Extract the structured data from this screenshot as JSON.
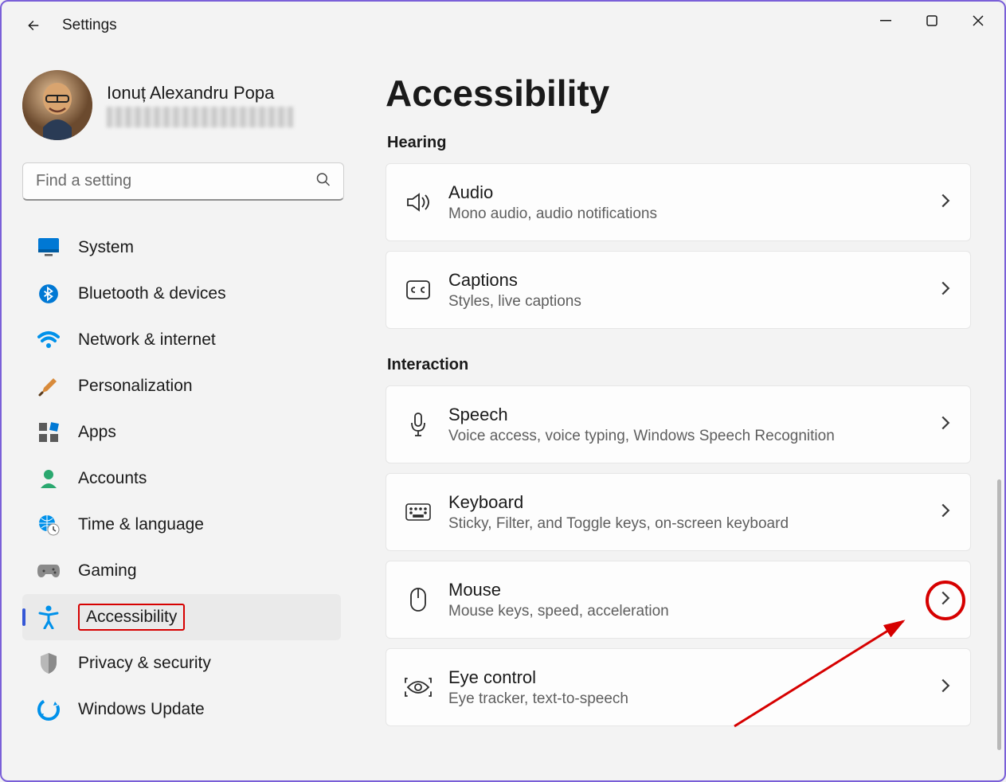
{
  "app_title": "Settings",
  "user": {
    "name": "Ionuț Alexandru Popa"
  },
  "search": {
    "placeholder": "Find a setting"
  },
  "sidebar": {
    "items": [
      {
        "id": "system",
        "label": "System"
      },
      {
        "id": "bluetooth",
        "label": "Bluetooth & devices"
      },
      {
        "id": "network",
        "label": "Network & internet"
      },
      {
        "id": "personalization",
        "label": "Personalization"
      },
      {
        "id": "apps",
        "label": "Apps"
      },
      {
        "id": "accounts",
        "label": "Accounts"
      },
      {
        "id": "time-language",
        "label": "Time & language"
      },
      {
        "id": "gaming",
        "label": "Gaming"
      },
      {
        "id": "accessibility",
        "label": "Accessibility"
      },
      {
        "id": "privacy",
        "label": "Privacy & security"
      },
      {
        "id": "update",
        "label": "Windows Update"
      }
    ]
  },
  "main": {
    "title": "Accessibility",
    "sections": [
      {
        "header": "Hearing",
        "items": [
          {
            "id": "audio",
            "title": "Audio",
            "sub": "Mono audio, audio notifications"
          },
          {
            "id": "captions",
            "title": "Captions",
            "sub": "Styles, live captions"
          }
        ]
      },
      {
        "header": "Interaction",
        "items": [
          {
            "id": "speech",
            "title": "Speech",
            "sub": "Voice access, voice typing, Windows Speech Recognition"
          },
          {
            "id": "keyboard",
            "title": "Keyboard",
            "sub": "Sticky, Filter, and Toggle keys, on-screen keyboard"
          },
          {
            "id": "mouse",
            "title": "Mouse",
            "sub": "Mouse keys, speed, acceleration"
          },
          {
            "id": "eye-control",
            "title": "Eye control",
            "sub": "Eye tracker, text-to-speech"
          }
        ]
      }
    ]
  }
}
